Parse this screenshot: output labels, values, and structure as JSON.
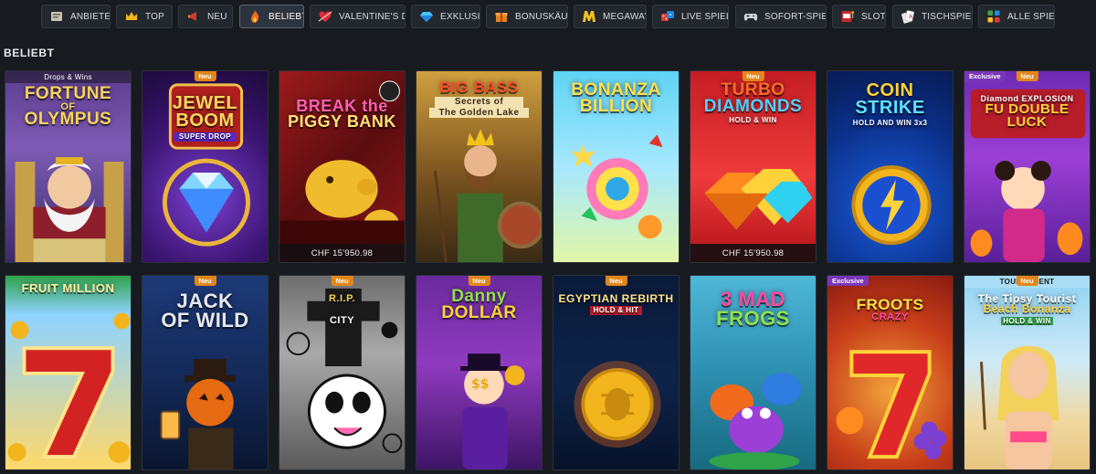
{
  "nav": {
    "items": [
      {
        "label": "ANBIETER",
        "icon": "book-icon",
        "active": false
      },
      {
        "label": "TOP",
        "icon": "crown-icon",
        "active": false
      },
      {
        "label": "NEU",
        "icon": "megaphone-icon",
        "active": false
      },
      {
        "label": "BELIEBT",
        "icon": "flame-icon",
        "active": true
      },
      {
        "label": "VALENTINE'S DAY",
        "icon": "heart-arrow-icon",
        "active": false
      },
      {
        "label": "EXKLUSIV",
        "icon": "diamond-icon",
        "active": false
      },
      {
        "label": "BONUSKÄUFE",
        "icon": "gift-icon",
        "active": false
      },
      {
        "label": "MEGAWAYS",
        "icon": "megaways-m-icon",
        "active": false
      },
      {
        "label": "LIVE SPIELE",
        "icon": "dice-icon",
        "active": false
      },
      {
        "label": "SOFORT-SPIELE",
        "icon": "gamepad-icon",
        "active": false
      },
      {
        "label": "SLOTS",
        "icon": "slot-machine-icon",
        "active": false
      },
      {
        "label": "TISCHSPIELE",
        "icon": "cards-icon",
        "active": false
      },
      {
        "label": "ALLE SPIELE",
        "icon": "grid-icon",
        "active": false
      }
    ]
  },
  "section": {
    "title": "BELIEBT"
  },
  "games": [
    {
      "title_lines": [
        "FORTUNE",
        "OF",
        "OLYMPUS"
      ],
      "ribbon": "Drops & Wins",
      "badge": "",
      "jackpot": ""
    },
    {
      "title_lines": [
        "JEWEL",
        "BOOM"
      ],
      "subtitle": "SUPER DROP",
      "ribbon": "",
      "badge": "Neu",
      "jackpot": ""
    },
    {
      "title_lines": [
        "BREAK the",
        "PIGGY BANK"
      ],
      "ribbon": "",
      "badge": "",
      "jackpot": "CHF 15'950.98"
    },
    {
      "title_lines": [
        "BIG BASS",
        "Secrets of",
        "The Golden Lake"
      ],
      "ribbon": "",
      "badge": "",
      "jackpot": ""
    },
    {
      "title_lines": [
        "BONANZA",
        "BILLION"
      ],
      "ribbon": "",
      "badge": "",
      "jackpot": ""
    },
    {
      "title_lines": [
        "TURBO",
        "DIAMONDS"
      ],
      "subtitle": "HOLD & WIN",
      "ribbon": "",
      "badge": "Neu",
      "jackpot": "CHF 15'950.98"
    },
    {
      "title_lines": [
        "COIN",
        "STRIKE"
      ],
      "subtitle": "HOLD AND WIN 3x3",
      "ribbon": "",
      "badge": "",
      "jackpot": ""
    },
    {
      "title_lines": [
        "Diamond EXPLOSION",
        "FU DOUBLE",
        "LUCK"
      ],
      "ribbon": "",
      "badge": "Neu",
      "badge2": "Exclusive",
      "jackpot": ""
    },
    {
      "title_lines": [
        "FRUIT MILLION"
      ],
      "ribbon": "",
      "badge": "",
      "jackpot": ""
    },
    {
      "title_lines": [
        "JACK",
        "OF WILD"
      ],
      "ribbon": "",
      "badge": "Neu",
      "jackpot": ""
    },
    {
      "title_lines": [
        "R.I.P.",
        "CITY"
      ],
      "ribbon": "",
      "badge": "Neu",
      "jackpot": ""
    },
    {
      "title_lines": [
        "Danny",
        "DOLLAR"
      ],
      "ribbon": "",
      "badge": "Neu",
      "jackpot": ""
    },
    {
      "title_lines": [
        "EGYPTIAN REBIRTH"
      ],
      "subtitle": "HOLD & HIT",
      "ribbon": "",
      "badge": "Neu",
      "jackpot": ""
    },
    {
      "title_lines": [
        "3 MAD",
        "FROGS"
      ],
      "ribbon": "",
      "badge": "",
      "jackpot": ""
    },
    {
      "title_lines": [
        "FROOTS",
        "CRAZY"
      ],
      "ribbon": "",
      "badge": "",
      "badge2": "Exclusive",
      "jackpot": ""
    },
    {
      "title_lines": [
        "The Tipsy Tourist",
        "Beach Bonanza"
      ],
      "subtitle": "HOLD & WIN",
      "ribbon": "TOURNAMENT",
      "badge": "Neu",
      "jackpot": ""
    }
  ],
  "colors": {
    "page_bg": "#171a1f",
    "chip_bg": "#23272e",
    "badge_new": "#e2861b",
    "badge_exclusive": "#7a35b8"
  }
}
